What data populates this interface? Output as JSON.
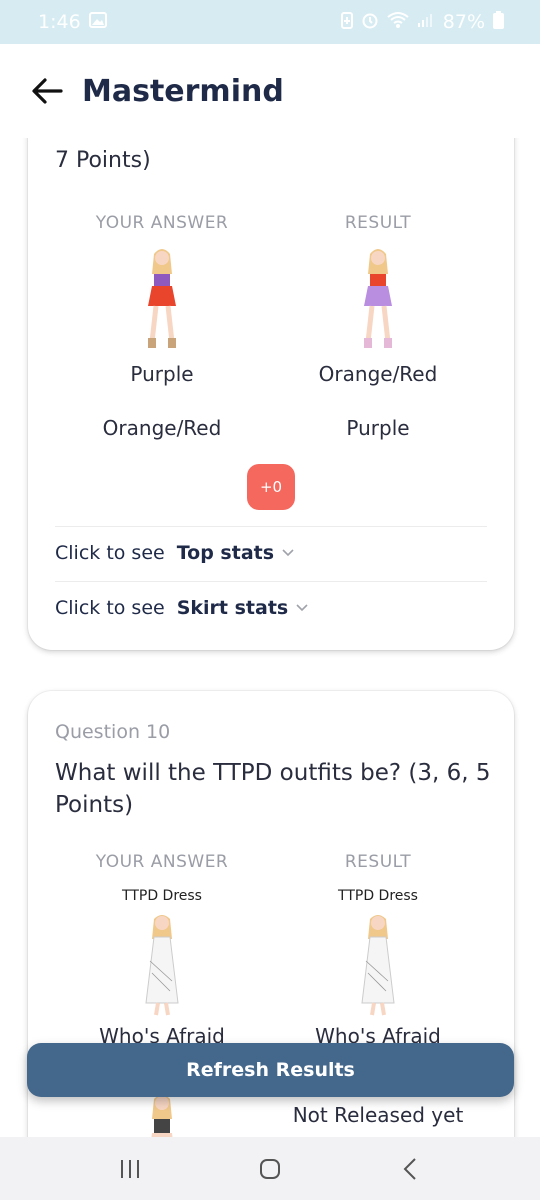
{
  "status": {
    "time": "1:46",
    "battery": "87%"
  },
  "header": {
    "title": "Mastermind"
  },
  "card_prev": {
    "title_tail": "7 Points)",
    "your_answer_label": "YOUR ANSWER",
    "result_label": "RESULT",
    "answer_top": "Purple",
    "answer_bottom": "Orange/Red",
    "result_top": "Orange/Red",
    "result_bottom": "Purple",
    "points": "+0",
    "stats": [
      {
        "prefix": "Click to see",
        "name": "Top stats"
      },
      {
        "prefix": "Click to see",
        "name": "Skirt stats"
      }
    ]
  },
  "card_q10": {
    "label": "Question 10",
    "title": "What will the TTPD outfits be? (3, 6, 5 Points)",
    "your_answer_label": "YOUR ANSWER",
    "result_label": "RESULT",
    "answer_outfit": "TTPD Dress",
    "result_outfit": "TTPD Dress",
    "answer_second": "Who's Afraid",
    "result_second": "Who's Afraid",
    "result_third": "Not Released yet"
  },
  "refresh_button": "Refresh Results",
  "colors": {
    "accent": "#44678c",
    "badge": "#f4685e",
    "title": "#1f2a48"
  }
}
